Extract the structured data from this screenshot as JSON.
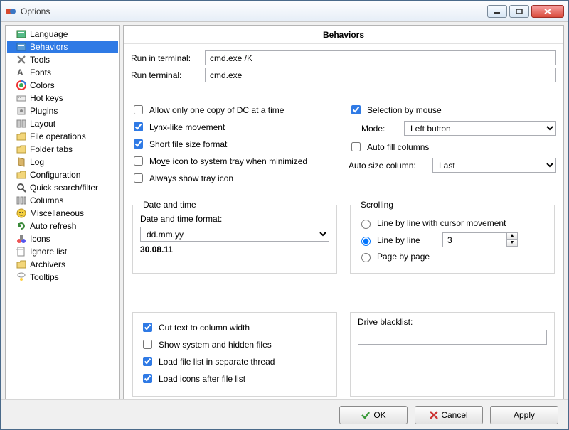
{
  "window": {
    "title": "Options"
  },
  "sidebar": {
    "items": [
      {
        "label": "Language",
        "icon": "language"
      },
      {
        "label": "Behaviors",
        "icon": "behaviors",
        "selected": true
      },
      {
        "label": "Tools",
        "icon": "tools"
      },
      {
        "label": "Fonts",
        "icon": "fonts"
      },
      {
        "label": "Colors",
        "icon": "colors"
      },
      {
        "label": "Hot keys",
        "icon": "hotkeys"
      },
      {
        "label": "Plugins",
        "icon": "plugins"
      },
      {
        "label": "Layout",
        "icon": "layout"
      },
      {
        "label": "File operations",
        "icon": "fileops"
      },
      {
        "label": "Folder tabs",
        "icon": "foldertabs"
      },
      {
        "label": "Log",
        "icon": "log"
      },
      {
        "label": "Configuration",
        "icon": "config"
      },
      {
        "label": "Quick search/filter",
        "icon": "search"
      },
      {
        "label": "Columns",
        "icon": "columns"
      },
      {
        "label": "Miscellaneous",
        "icon": "misc"
      },
      {
        "label": "Auto refresh",
        "icon": "refresh"
      },
      {
        "label": "Icons",
        "icon": "icons"
      },
      {
        "label": "Ignore list",
        "icon": "ignore"
      },
      {
        "label": "Archivers",
        "icon": "archive"
      },
      {
        "label": "Tooltips",
        "icon": "tooltip"
      }
    ]
  },
  "panel": {
    "title": "Behaviors",
    "run_in_terminal_label": "Run in terminal:",
    "run_in_terminal_value": "cmd.exe /K",
    "run_terminal_label": "Run terminal:",
    "run_terminal_value": "cmd.exe",
    "left_checks": {
      "allow_one_copy": {
        "label": "Allow only one copy of DC at a time",
        "checked": false
      },
      "lynx_movement": {
        "label": "Lynx-like movement",
        "checked": true
      },
      "short_size": {
        "label": "Short file size format",
        "checked": true
      },
      "tray_minimize": {
        "label": "Move icon to system tray when minimized",
        "checked": false,
        "underline": "v"
      },
      "always_tray": {
        "label": "Always show tray icon",
        "checked": false
      }
    },
    "right_checks": {
      "selection_mouse": {
        "label": "Selection by mouse",
        "checked": true
      },
      "mode_label": "Mode:",
      "mode_value": "Left button",
      "auto_fill": {
        "label": "Auto fill columns",
        "checked": false
      },
      "auto_size_label": "Auto size column:",
      "auto_size_value": "Last"
    },
    "datetime": {
      "legend": "Date and time",
      "format_label": "Date and time format:",
      "format_value": "dd.mm.yy",
      "example": "30.08.11"
    },
    "scrolling": {
      "legend": "Scrolling",
      "line_cursor": "Line by line with cursor movement",
      "line_by_line": "Line by line",
      "line_value": "3",
      "page_by_page": "Page by page",
      "selected": "line_by_line"
    },
    "bottom_left": {
      "cut_text": {
        "label": "Cut text to column width",
        "checked": true
      },
      "show_hidden": {
        "label": "Show system and hidden files",
        "checked": false
      },
      "load_thread": {
        "label": "Load file list in separate thread",
        "checked": true
      },
      "load_icons": {
        "label": "Load icons after file list",
        "checked": true
      }
    },
    "bottom_right": {
      "drive_blacklist_label": "Drive blacklist:",
      "drive_blacklist_value": ""
    }
  },
  "footer": {
    "ok": "OK",
    "cancel": "Cancel",
    "apply": "Apply"
  }
}
